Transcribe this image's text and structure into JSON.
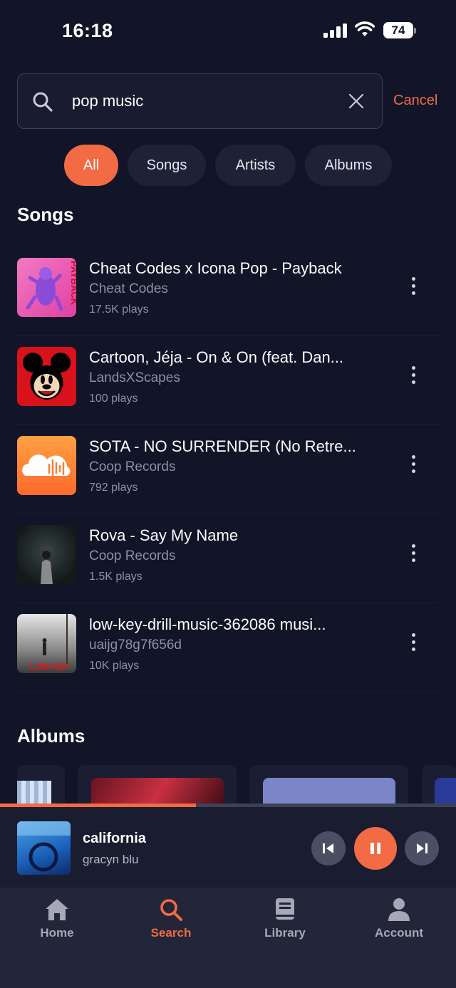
{
  "status": {
    "time": "16:18",
    "battery": "74"
  },
  "search": {
    "value": "pop music",
    "placeholder": "",
    "cancel_label": "Cancel"
  },
  "filters": [
    {
      "label": "All",
      "active": true
    },
    {
      "label": "Songs",
      "active": false
    },
    {
      "label": "Artists",
      "active": false
    },
    {
      "label": "Albums",
      "active": false
    }
  ],
  "sections": {
    "songs": "Songs",
    "albums": "Albums"
  },
  "songs": [
    {
      "title": "Cheat Codes x Icona Pop - Payback",
      "artist": "Cheat Codes",
      "plays": "17.5K plays",
      "art_text": "PAYBACK"
    },
    {
      "title": "Cartoon, Jéja - On & On (feat. Dan...",
      "artist": "LandsXScapes",
      "plays": "100 plays"
    },
    {
      "title": "SOTA - NO SURRENDER (No Retre...",
      "artist": "Coop Records",
      "plays": "792 plays"
    },
    {
      "title": "Rova - Say My Name",
      "artist": "Coop Records",
      "plays": "1.5K plays"
    },
    {
      "title": "low-key-drill-music-362086 musi...",
      "artist": "uaijg78g7f656d",
      "plays": "10K plays",
      "art_text": "LOW KEY"
    }
  ],
  "player": {
    "title": "california",
    "artist": "gracyn blu",
    "progress": 0.43
  },
  "tabs": [
    {
      "label": "Home",
      "icon": "home-icon",
      "active": false
    },
    {
      "label": "Search",
      "icon": "search-icon",
      "active": true
    },
    {
      "label": "Library",
      "icon": "library-icon",
      "active": false
    },
    {
      "label": "Account",
      "icon": "account-icon",
      "active": false
    }
  ],
  "colors": {
    "background": "#121428",
    "accent": "#f26b44",
    "muted": "#8e91a4",
    "tab_inactive": "#a6a8b8"
  }
}
